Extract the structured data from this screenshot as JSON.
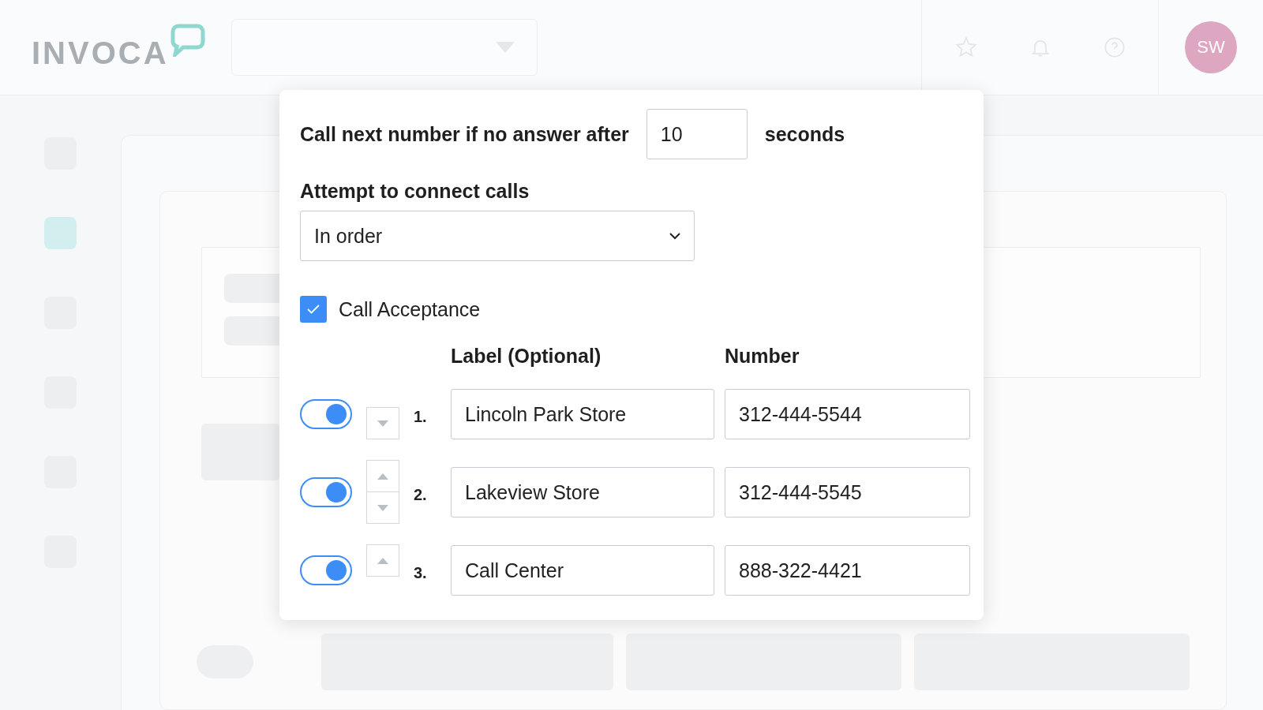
{
  "header": {
    "logo": "INVOCA",
    "avatar": "SW"
  },
  "sidebar": {
    "items": [
      {
        "selected": false
      },
      {
        "selected": true
      },
      {
        "selected": false
      },
      {
        "selected": false
      },
      {
        "selected": false
      },
      {
        "selected": false
      }
    ]
  },
  "dialog": {
    "timeout_label": "Call next number if no answer after",
    "timeout_value": "10",
    "timeout_unit": "seconds",
    "order_label": "Attempt to connect calls",
    "order_value": "In order",
    "acceptance": {
      "label": "Call Acceptance",
      "checked": true
    },
    "columns": [
      "Label (Optional)",
      "Number"
    ],
    "rows": [
      {
        "on": true,
        "index": "1.",
        "label": "Lincoln Park Store",
        "number": "312-444-5544",
        "move_up": false,
        "move_down": true
      },
      {
        "on": true,
        "index": "2.",
        "label": "Lakeview Store",
        "number": "312-444-5545",
        "move_up": true,
        "move_down": true
      },
      {
        "on": true,
        "index": "3.",
        "label": "Call Center",
        "number": "888-322-4421",
        "move_up": true,
        "move_down": false
      }
    ]
  }
}
